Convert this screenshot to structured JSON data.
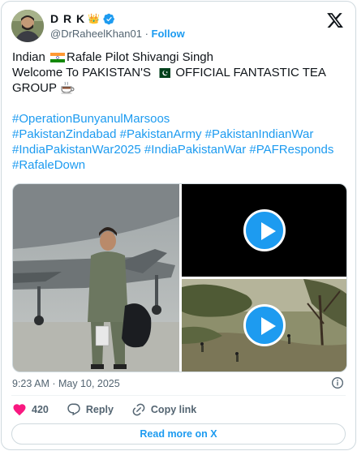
{
  "author": {
    "display_name": "D R K",
    "crown_emoji": "👑",
    "handle": "@DrRaheelKhan01",
    "separator": "·",
    "follow_label": "Follow"
  },
  "tweet": {
    "line1_a": "Indian",
    "line1_b": "Rafale Pilot Shivangi Singh",
    "line2_a": "Welcome To PAKISTAN'S",
    "line2_b": "OFFICIAL FANTASTIC TEA",
    "line3": "GROUP",
    "hashtags": {
      "h1": "#OperationBunyanulMarsoos",
      "h2": "#PakistanZindabad",
      "h3": "#PakistanArmy",
      "h4": "#PakistanIndianWar",
      "h5": "#IndiaPakistanWar2025",
      "h6": "#IndiaPakistanWar",
      "h7": "#PAFResponds",
      "h8": "#RafaleDown"
    }
  },
  "timestamp": "9:23 AM · May 10, 2025",
  "actions": {
    "like_count": "420",
    "reply_label": "Reply",
    "copy_label": "Copy link"
  },
  "read_more_label": "Read more on X",
  "colors": {
    "accent": "#1d9bf0",
    "like": "#f91880",
    "muted": "#536471"
  }
}
